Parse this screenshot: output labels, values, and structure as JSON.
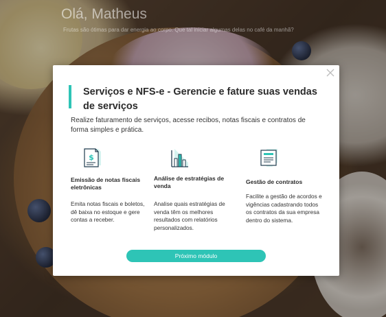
{
  "background": {
    "greeting": "Olá, Matheus",
    "subgreeting": "Frutas são ótimas para dar energia ao corpo. Que tal iniciar algumas delas no café da manhã?"
  },
  "modal": {
    "title": "Serviços e NFS-e - Gerencie e fature suas vendas de serviços",
    "description": "Realize faturamento de serviços, acesse recibos, notas fiscais e contratos de forma simples e prática.",
    "features": [
      {
        "icon": "invoice-document-icon",
        "title": "Emissão de notas fiscais eletrônicas",
        "text": "Emita notas fiscais e boletos, dê baixa no estoque e gere contas a receber."
      },
      {
        "icon": "bar-chart-icon",
        "title": "Análise de estratégias de venda",
        "text": "Analise quais estratégias de venda têm os melhores resultados com relatórios personalizados."
      },
      {
        "icon": "contract-document-icon",
        "title": "Gestão de contratos",
        "text": "Facilite a gestão de acordos e vigências cadastrando todos os contratos da sua empresa dentro do sistema."
      }
    ],
    "next_button": "Próximo módulo",
    "close_icon": "close-icon"
  },
  "colors": {
    "accent": "#2ec4b6",
    "text": "#2b2b2b"
  }
}
